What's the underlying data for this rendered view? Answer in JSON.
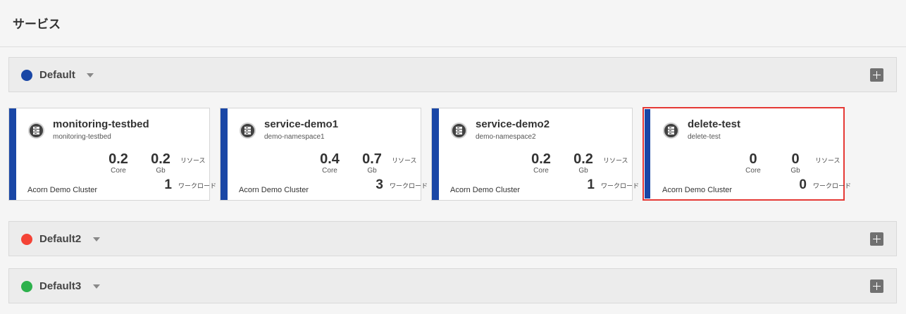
{
  "page": {
    "title": "サービス"
  },
  "groups": [
    {
      "name": "Default",
      "color": "#1a47a6"
    },
    {
      "name": "Default2",
      "color": "#f44336"
    },
    {
      "name": "Default3",
      "color": "#2db14c"
    }
  ],
  "labels": {
    "resource": "リソース",
    "workload": "ワークロード",
    "core_unit": "Core",
    "gb_unit": "Gb"
  },
  "cards": [
    {
      "name": "monitoring-testbed",
      "namespace": "monitoring-testbed",
      "core": "0.2",
      "gb": "0.2",
      "workloads": "1",
      "cluster": "Acorn Demo Cluster",
      "selected": false
    },
    {
      "name": "service-demo1",
      "namespace": "demo-namespace1",
      "core": "0.4",
      "gb": "0.7",
      "workloads": "3",
      "cluster": "Acorn Demo Cluster",
      "selected": false
    },
    {
      "name": "service-demo2",
      "namespace": "demo-namespace2",
      "core": "0.2",
      "gb": "0.2",
      "workloads": "1",
      "cluster": "Acorn Demo Cluster",
      "selected": false
    },
    {
      "name": "delete-test",
      "namespace": "delete-test",
      "core": "0",
      "gb": "0",
      "workloads": "0",
      "cluster": "Acorn Demo Cluster",
      "selected": true
    }
  ],
  "colors": {
    "accent": "#1a47a6",
    "selection": "#e53935"
  },
  "icons": {
    "service": "service-icon",
    "add": "plus-icon",
    "expand": "chevron-down-icon"
  }
}
